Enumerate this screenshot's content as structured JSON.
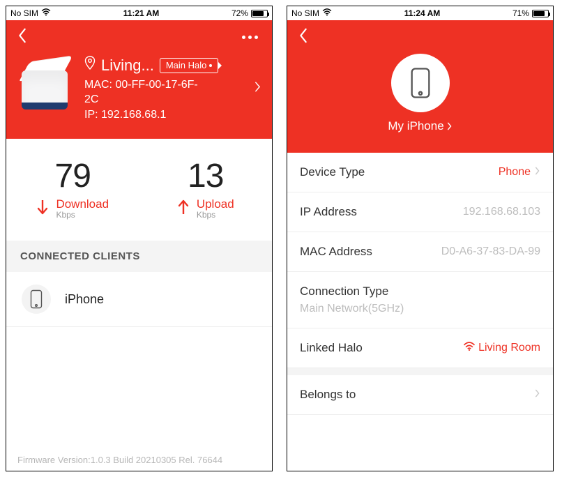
{
  "left": {
    "status": {
      "carrier": "No SIM",
      "time": "11:21 AM",
      "battery_pct": "72%",
      "battery_fill_pct": 72
    },
    "hero": {
      "room": "Living...",
      "tag": "Main Halo",
      "mac_label": "MAC: 00-FF-00-17-6F-2C",
      "ip_label": "IP: 192.168.68.1"
    },
    "speed": {
      "download_value": "79",
      "download_label": "Download",
      "download_unit": "Kbps",
      "upload_value": "13",
      "upload_label": "Upload",
      "upload_unit": "Kbps"
    },
    "section_title": "CONNECTED CLIENTS",
    "clients": [
      {
        "name": "iPhone"
      }
    ],
    "footer": "Firmware Version:1.0.3 Build 20210305 Rel. 76644"
  },
  "right": {
    "status": {
      "carrier": "No SIM",
      "time": "11:24 AM",
      "battery_pct": "71%",
      "battery_fill_pct": 71
    },
    "device_name": "My iPhone",
    "rows": {
      "device_type": {
        "label": "Device Type",
        "value": "Phone"
      },
      "ip": {
        "label": "IP Address",
        "value": "192.168.68.103"
      },
      "mac": {
        "label": "MAC Address",
        "value": "D0-A6-37-83-DA-99"
      },
      "conn": {
        "label": "Connection Type",
        "value": "Main Network(5GHz)"
      },
      "linked": {
        "label": "Linked Halo",
        "value": "Living Room"
      },
      "belongs": {
        "label": "Belongs to",
        "value": ""
      }
    }
  }
}
